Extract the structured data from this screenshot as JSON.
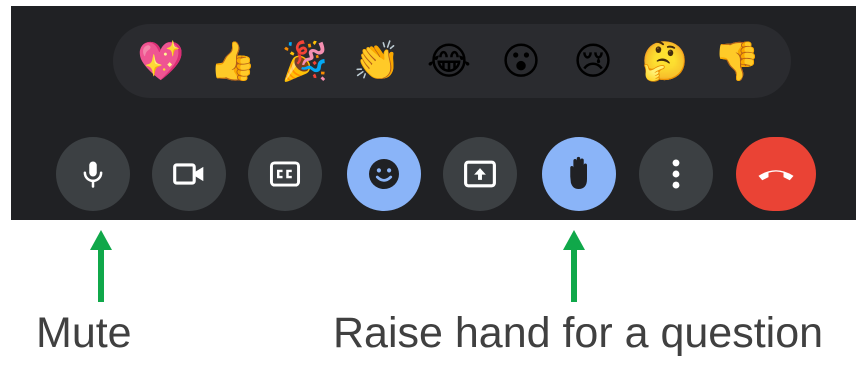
{
  "reactions": [
    {
      "name": "sparkling-heart-icon",
      "glyph": "💖"
    },
    {
      "name": "thumbs-up-icon",
      "glyph": "👍"
    },
    {
      "name": "party-popper-icon",
      "glyph": "🎉"
    },
    {
      "name": "clapping-hands-icon",
      "glyph": "👏"
    },
    {
      "name": "tears-of-joy-icon",
      "glyph": "😂"
    },
    {
      "name": "surprised-face-icon",
      "glyph": "😮"
    },
    {
      "name": "crying-face-icon",
      "glyph": "😢"
    },
    {
      "name": "thinking-face-icon",
      "glyph": "🤔"
    },
    {
      "name": "thumbs-down-icon",
      "glyph": "👎"
    }
  ],
  "controls": [
    {
      "name": "microphone-button",
      "icon": "microphone-icon",
      "state": "off"
    },
    {
      "name": "camera-button",
      "icon": "video-camera-icon",
      "state": "off"
    },
    {
      "name": "captions-button",
      "icon": "closed-captions-icon",
      "state": "off"
    },
    {
      "name": "reactions-button",
      "icon": "smiley-face-icon",
      "state": "active"
    },
    {
      "name": "present-screen-button",
      "icon": "present-screen-icon",
      "state": "off"
    },
    {
      "name": "raise-hand-button",
      "icon": "hand-icon",
      "state": "active"
    },
    {
      "name": "more-options-button",
      "icon": "more-vertical-icon",
      "state": "off"
    },
    {
      "name": "leave-call-button",
      "icon": "hang-up-icon",
      "state": "off"
    }
  ],
  "annotations": {
    "mute_label": "Mute",
    "raise_hand_label": "Raise hand for a question"
  },
  "colors": {
    "bar_background": "#202124",
    "reaction_tray": "#2a2b2f",
    "button_default": "#3c4043",
    "button_active": "#8ab4f8",
    "end_call": "#ea4335",
    "arrow": "#10a84a",
    "caption_text": "#404040"
  }
}
